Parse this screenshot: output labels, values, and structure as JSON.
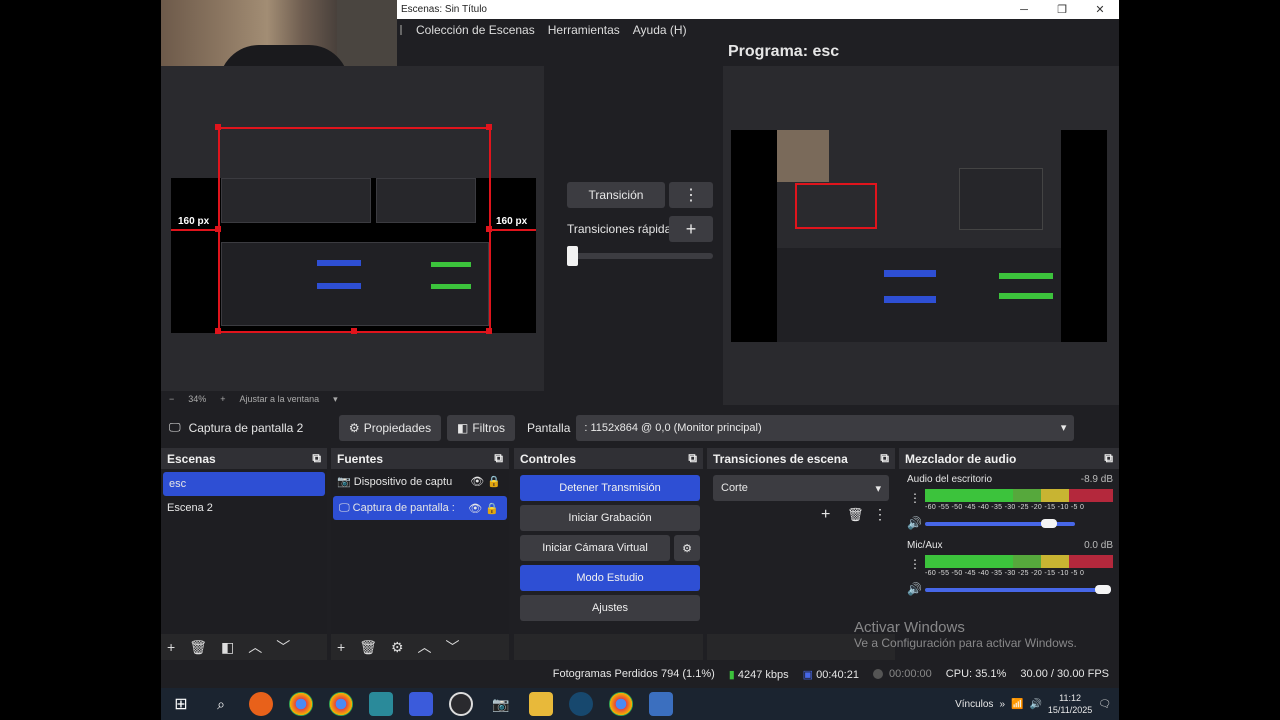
{
  "window": {
    "title": "Escenas: Sin Título",
    "minimize": "─",
    "maximize": "❐",
    "close": "✕"
  },
  "menu": [
    "Colección de Escenas",
    "Herramientas",
    "Ayuda (H)"
  ],
  "program_label": "Programa: esc",
  "preview": {
    "left_px": "160 px",
    "right_px": "160 px",
    "zoom": "34%",
    "fit_label": "Ajustar a la ventana"
  },
  "transition": {
    "button": "Transición",
    "quick": "Transiciones rápidas"
  },
  "source_toolbar": {
    "name": "Captura de pantalla 2",
    "properties": "Propiedades",
    "filters": "Filtros",
    "screen_label": "Pantalla",
    "screen_value": ": 1152x864 @ 0,0 (Monitor principal)"
  },
  "docks": {
    "scenes": {
      "title": "Escenas",
      "items": [
        "esc",
        "Escena 2"
      ]
    },
    "sources": {
      "title": "Fuentes",
      "items": [
        "Dispositivo de captu",
        "Captura de pantalla :"
      ]
    },
    "controls": {
      "title": "Controles",
      "stop_stream": "Detener Transmisión",
      "start_record": "Iniciar Grabación",
      "virtual_cam": "Iniciar Cámara Virtual",
      "studio": "Modo Estudio",
      "settings": "Ajustes"
    },
    "transitions": {
      "title": "Transiciones de escena",
      "value": "Corte"
    },
    "mixer": {
      "title": "Mezclador de audio",
      "channels": [
        {
          "name": "Audio del escritorio",
          "db": "-8.9 dB",
          "volume": 0.95
        },
        {
          "name": "Mic/Aux",
          "db": "0.0 dB",
          "volume": 1.0
        }
      ],
      "ticks": "-60 -55 -50 -45 -40 -35 -30 -25 -20 -15 -10 -5 0"
    }
  },
  "status": {
    "dropped": "Fotogramas Perdidos 794 (1.1%)",
    "bitrate": "4247 kbps",
    "stream_time": "00:40:21",
    "rec_time": "00:00:00",
    "cpu": "CPU: 35.1%",
    "fps": "30.00 / 30.00 FPS"
  },
  "watermark": {
    "title": "Activar Windows",
    "sub": "Ve a Configuración para activar Windows."
  },
  "taskbar": {
    "links": "Vínculos",
    "time": "11:12",
    "date": "15/11/2025"
  },
  "colors": {
    "accent": "#2e4fd4",
    "selection_red": "#e0141c",
    "meter_green": "#3cc33c",
    "meter_yellow": "#c8b432",
    "meter_red": "#b4283c"
  }
}
